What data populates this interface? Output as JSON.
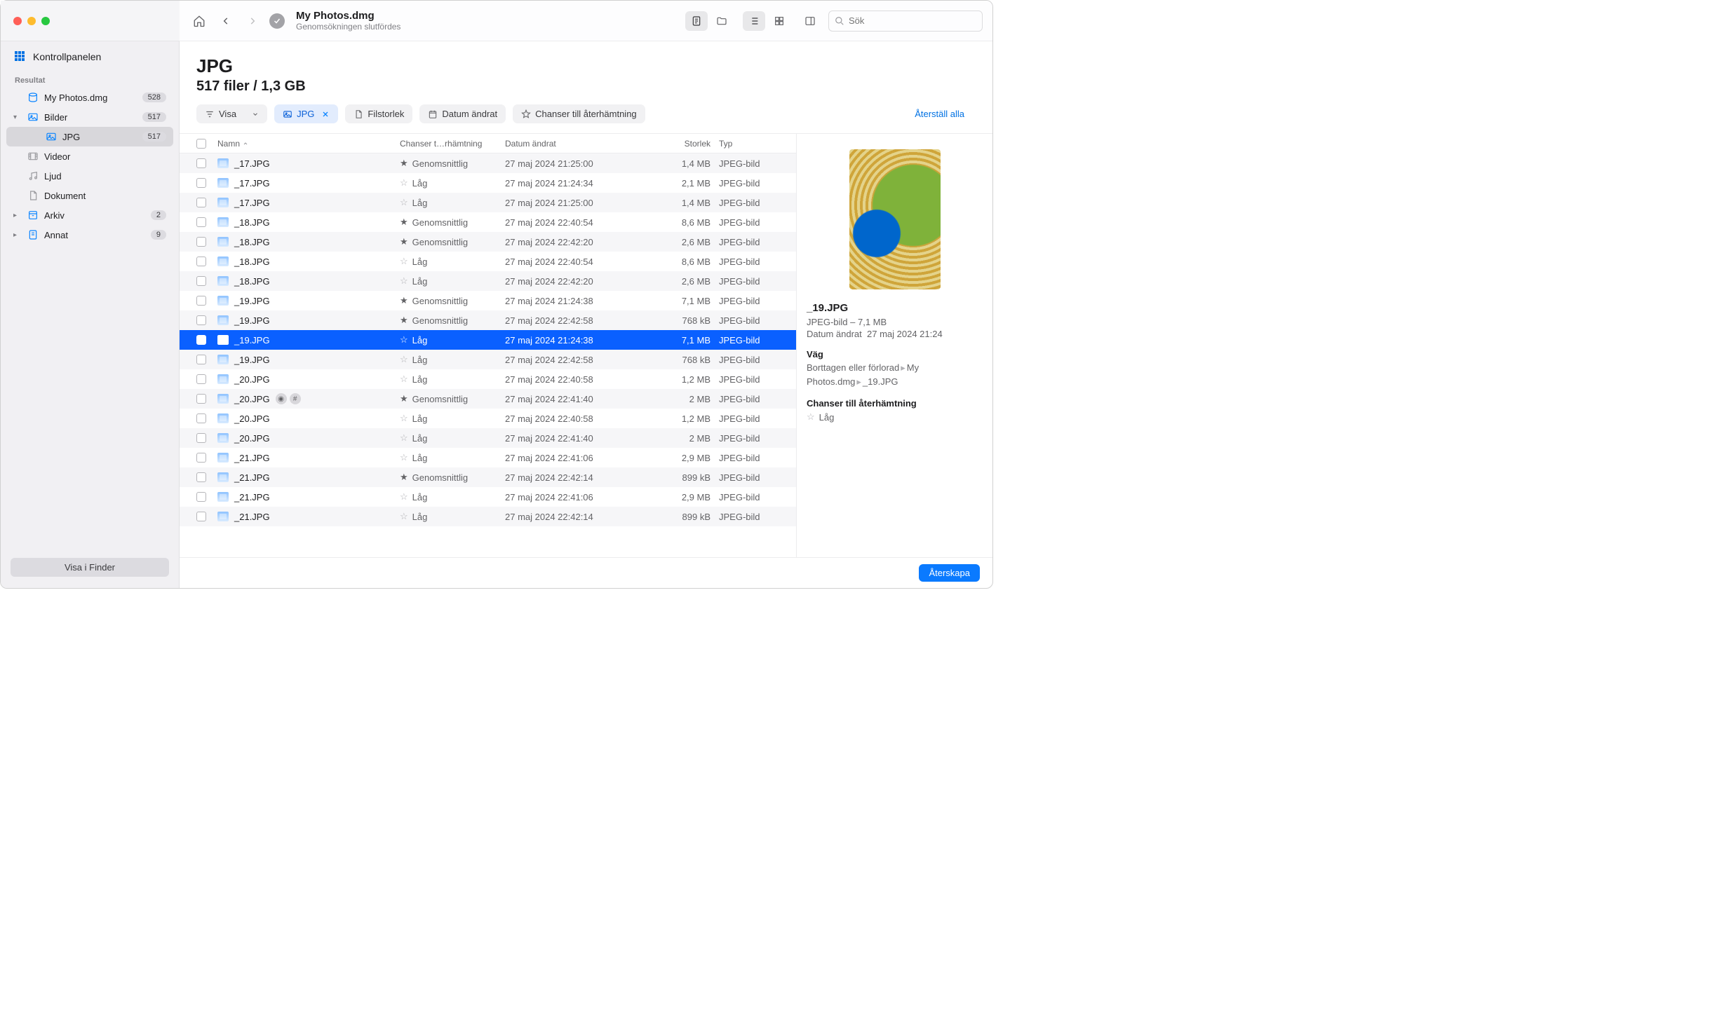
{
  "titlebar": {},
  "sidebar": {
    "control_panel": "Kontrollpanelen",
    "section_title": "Resultat",
    "items": [
      {
        "icon": "disk",
        "label": "My Photos.dmg",
        "badge": "528",
        "chev": ""
      },
      {
        "icon": "image",
        "label": "Bilder",
        "badge": "517",
        "chev": "▾"
      },
      {
        "icon": "image",
        "label": "JPG",
        "badge": "517",
        "chev": "",
        "indent": true,
        "active": true
      },
      {
        "icon": "video",
        "label": "Videor",
        "badge": "",
        "chev": ""
      },
      {
        "icon": "audio",
        "label": "Ljud",
        "badge": "",
        "chev": ""
      },
      {
        "icon": "doc",
        "label": "Dokument",
        "badge": "",
        "chev": ""
      },
      {
        "icon": "archive",
        "label": "Arkiv",
        "badge": "2",
        "chev": "▸"
      },
      {
        "icon": "other",
        "label": "Annat",
        "badge": "9",
        "chev": "▸"
      }
    ],
    "finder_btn": "Visa i Finder"
  },
  "toolbar": {
    "title": "My Photos.dmg",
    "subtitle": "Genomsökningen slutfördes",
    "search_placeholder": "Sök"
  },
  "header": {
    "title": "JPG",
    "subtitle": "517 filer / 1,3 GB"
  },
  "filters": {
    "show_label": "Visa",
    "jpg_label": "JPG",
    "size_label": "Filstorlek",
    "date_label": "Datum ändrat",
    "chance_label": "Chanser till återhämtning",
    "reset": "Återställ alla"
  },
  "columns": {
    "name": "Namn",
    "chance": "Chanser t…rhämtning",
    "date": "Datum ändrat",
    "size": "Storlek",
    "type": "Typ"
  },
  "chance_values": {
    "avg": "Genomsnittlig",
    "low": "Låg"
  },
  "type_value": "JPEG-bild",
  "rows": [
    {
      "name": "_17.JPG",
      "chance": "avg",
      "date": "27 maj 2024 21:25:00",
      "size": "1,4 MB"
    },
    {
      "name": "_17.JPG",
      "chance": "low",
      "date": "27 maj 2024 21:24:34",
      "size": "2,1 MB"
    },
    {
      "name": "_17.JPG",
      "chance": "low",
      "date": "27 maj 2024 21:25:00",
      "size": "1,4 MB"
    },
    {
      "name": "_18.JPG",
      "chance": "avg",
      "date": "27 maj 2024 22:40:54",
      "size": "8,6 MB"
    },
    {
      "name": "_18.JPG",
      "chance": "avg",
      "date": "27 maj 2024 22:42:20",
      "size": "2,6 MB"
    },
    {
      "name": "_18.JPG",
      "chance": "low",
      "date": "27 maj 2024 22:40:54",
      "size": "8,6 MB"
    },
    {
      "name": "_18.JPG",
      "chance": "low",
      "date": "27 maj 2024 22:42:20",
      "size": "2,6 MB"
    },
    {
      "name": "_19.JPG",
      "chance": "avg",
      "date": "27 maj 2024 21:24:38",
      "size": "7,1 MB"
    },
    {
      "name": "_19.JPG",
      "chance": "avg",
      "date": "27 maj 2024 22:42:58",
      "size": "768 kB"
    },
    {
      "name": "_19.JPG",
      "chance": "low",
      "date": "27 maj 2024 21:24:38",
      "size": "7,1 MB",
      "selected": true
    },
    {
      "name": "_19.JPG",
      "chance": "low",
      "date": "27 maj 2024 22:42:58",
      "size": "768 kB"
    },
    {
      "name": "_20.JPG",
      "chance": "low",
      "date": "27 maj 2024 22:40:58",
      "size": "1,2 MB"
    },
    {
      "name": "_20.JPG",
      "chance": "avg",
      "date": "27 maj 2024 22:41:40",
      "size": "2 MB",
      "badges": true
    },
    {
      "name": "_20.JPG",
      "chance": "low",
      "date": "27 maj 2024 22:40:58",
      "size": "1,2 MB"
    },
    {
      "name": "_20.JPG",
      "chance": "low",
      "date": "27 maj 2024 22:41:40",
      "size": "2 MB"
    },
    {
      "name": "_21.JPG",
      "chance": "low",
      "date": "27 maj 2024 22:41:06",
      "size": "2,9 MB"
    },
    {
      "name": "_21.JPG",
      "chance": "avg",
      "date": "27 maj 2024 22:42:14",
      "size": "899 kB"
    },
    {
      "name": "_21.JPG",
      "chance": "low",
      "date": "27 maj 2024 22:41:06",
      "size": "2,9 MB"
    },
    {
      "name": "_21.JPG",
      "chance": "low",
      "date": "27 maj 2024 22:42:14",
      "size": "899 kB"
    }
  ],
  "preview": {
    "name": "_19.JPG",
    "type_size": "JPEG-bild – 7,1 MB",
    "date_label": "Datum ändrat",
    "date_value": "27 maj 2024 21:24",
    "path_label": "Väg",
    "path_prefix": "Borttagen eller förlorad",
    "path_mid": "My Photos.dmg",
    "path_file": "_19.JPG",
    "chance_label": "Chanser till återhämtning",
    "chance_value": "Låg"
  },
  "footer": {
    "recover": "Återskapa"
  }
}
